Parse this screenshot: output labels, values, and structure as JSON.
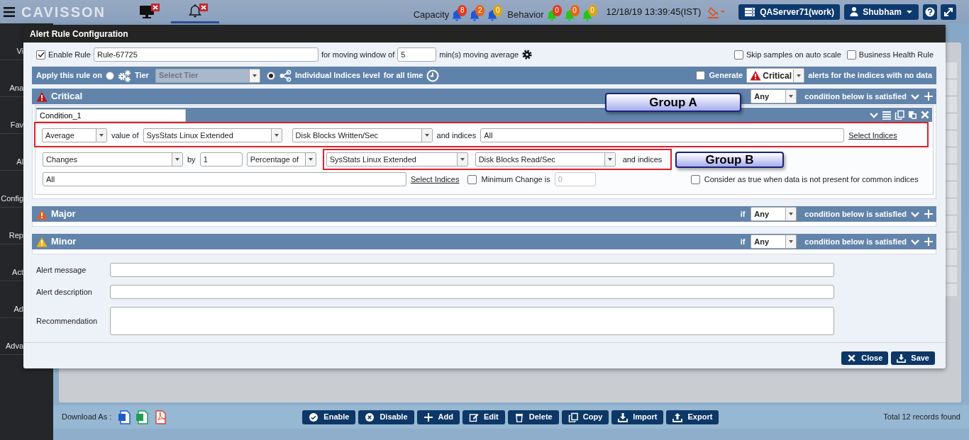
{
  "app_bar": {
    "logo": "CAVISSON",
    "tabs": [
      {
        "kind": "monitor",
        "selected": false
      },
      {
        "kind": "bell",
        "selected": true
      }
    ],
    "capacity": {
      "label": "Capacity",
      "alerts": [
        {
          "count": "8",
          "color": "#e23a1f"
        },
        {
          "count": "2",
          "color": "#e4661c"
        },
        {
          "count": "0",
          "color": "#dba514"
        }
      ]
    },
    "behavior": {
      "label": "Behavior",
      "alerts": [
        {
          "count": "0",
          "color": "#e23a1f"
        },
        {
          "count": "0",
          "color": "#e4661c"
        },
        {
          "count": "0",
          "color": "#dba514"
        }
      ]
    },
    "datetime": "12/18/19 13:39:45(IST)",
    "server": "QAServer71(work)",
    "user": "Shubham"
  },
  "sidebar": {
    "items": [
      "Vi",
      "Ana",
      "Fav",
      "Al",
      "Config",
      "Rep",
      "Act",
      "Ad",
      "Adva"
    ]
  },
  "dialog": {
    "title": "Alert Rule Configuration",
    "enable_rule": {
      "label": "Enable Rule",
      "checked": true
    },
    "rule_name": "Rule-67725",
    "window_label": "for moving window of",
    "window_value": "5",
    "window_unit": "min(s) moving average",
    "options": [
      {
        "label": "Skip samples on auto scale",
        "checked": false
      },
      {
        "label": "Business Health Rule",
        "checked": false
      }
    ],
    "apply": {
      "label": "Apply this rule on",
      "targets": [
        {
          "kind": "tier",
          "label": "Tier",
          "selected": false
        },
        {
          "kind": "indices",
          "label": "Individual Indices level",
          "selected": true
        }
      ],
      "tier_placeholder": "Select Tier",
      "period": "for all time",
      "generate": {
        "label": "Generate",
        "checked": false,
        "severity": "Critical",
        "suffix": "alerts for the indices with no data"
      }
    },
    "sections": [
      {
        "kind": "critical",
        "title": "Critical",
        "match": "Any",
        "condition_text": "condition below is satisfied",
        "conditions": [
          {
            "name": "Condition_1",
            "aggregate": "Average",
            "value_of": "value of",
            "group": "SysStats Linux Extended",
            "graph": "Disk Blocks Written/Sec",
            "indices_label": "and indices",
            "indices": "All",
            "select_indices": "Select Indices",
            "change_mode": "Changes",
            "by_label": "by",
            "by_value": "1",
            "change_unit": "Percentage of",
            "compare_group": "SysStats Linux Extended",
            "compare_graph": "Disk Blocks Read/Sec",
            "compare_indices_label": "and indices",
            "compare_indices": "All",
            "compare_select_indices": "Select Indices",
            "min_change": {
              "label": "Minimum Change is",
              "checked": false,
              "value": "0"
            },
            "consider_true": {
              "label": "Consider as true when data is not present for common indices",
              "checked": false
            }
          }
        ]
      },
      {
        "kind": "major",
        "title": "Major",
        "if_label": "if",
        "match": "Any",
        "condition_text": "condition below is satisfied"
      },
      {
        "kind": "minor",
        "title": "Minor",
        "if_label": "if",
        "match": "Any",
        "condition_text": "condition below is satisfied"
      }
    ],
    "annotations": [
      {
        "label": "Group A"
      },
      {
        "label": "Group B"
      }
    ],
    "fields": [
      {
        "kind": "input",
        "label": "Alert message"
      },
      {
        "kind": "input",
        "label": "Alert description"
      },
      {
        "kind": "textarea",
        "label": "Recommendation"
      }
    ],
    "buttons": [
      {
        "kind": "close",
        "label": "Close"
      },
      {
        "kind": "save",
        "label": "Save"
      }
    ]
  },
  "toolbar": {
    "download_label": "Download As :",
    "formats": [
      {
        "kind": "word"
      },
      {
        "kind": "excel"
      },
      {
        "kind": "pdf"
      }
    ],
    "buttons": [
      {
        "kind": "enable",
        "label": "Enable"
      },
      {
        "kind": "disable",
        "label": "Disable"
      },
      {
        "kind": "add",
        "label": "Add"
      },
      {
        "kind": "edit",
        "label": "Edit"
      },
      {
        "kind": "delete",
        "label": "Delete"
      },
      {
        "kind": "copy",
        "label": "Copy"
      },
      {
        "kind": "import",
        "label": "Import"
      },
      {
        "kind": "export",
        "label": "Export"
      }
    ],
    "total": "Total 12 records found"
  }
}
